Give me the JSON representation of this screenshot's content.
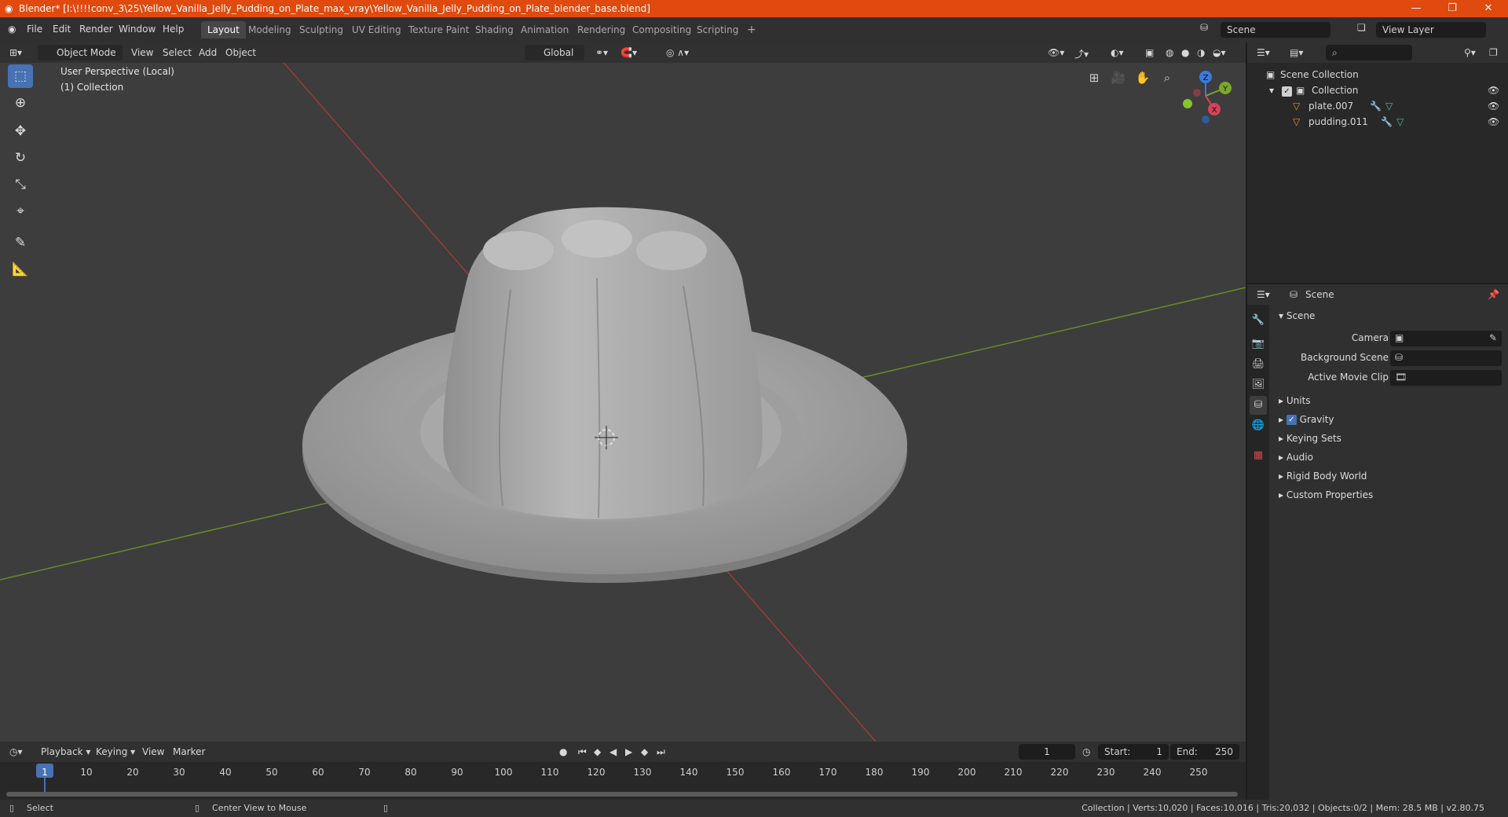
{
  "window": {
    "title": "Blender* [I:\\!!!!conv_3\\25\\Yellow_Vanilla_Jelly_Pudding_on_Plate_max_vray\\Yellow_Vanilla_Jelly_Pudding_on_Plate_blender_base.blend]",
    "minimize": "—",
    "maximize": "❐",
    "close": "✕"
  },
  "menus": [
    "File",
    "Edit",
    "Render",
    "Window",
    "Help"
  ],
  "workspaces": [
    "Layout",
    "Modeling",
    "Sculpting",
    "UV Editing",
    "Texture Paint",
    "Shading",
    "Animation",
    "Rendering",
    "Compositing",
    "Scripting"
  ],
  "add_workspace": "+",
  "scene_field": "Scene",
  "view_layer_field": "View Layer",
  "viewport": {
    "mode": "Object Mode",
    "menus": [
      "View",
      "Select",
      "Add",
      "Object"
    ],
    "transform": "Global",
    "overlay_line1": "User Perspective (Local)",
    "overlay_line2": "(1) Collection",
    "gizmo": {
      "z": "Z",
      "y": "Y",
      "x": "X"
    }
  },
  "outliner": {
    "root": "Scene Collection",
    "collection": "Collection",
    "items": [
      "plate.007",
      "pudding.011"
    ]
  },
  "properties": {
    "header": "Scene",
    "panel": "Scene",
    "camera_label": "Camera",
    "background_label": "Background Scene",
    "movieclip_label": "Active Movie Clip",
    "sections": [
      "Units",
      "Gravity",
      "Keying Sets",
      "Audio",
      "Rigid Body World",
      "Custom Properties"
    ]
  },
  "timeline": {
    "menus": [
      "Playback",
      "Keying",
      "View",
      "Marker"
    ],
    "current_frame": "1",
    "start_label": "Start:",
    "start": "1",
    "end_label": "End:",
    "end": "250",
    "ticks": [
      "1",
      "10",
      "20",
      "30",
      "40",
      "50",
      "60",
      "70",
      "80",
      "90",
      "100",
      "110",
      "120",
      "130",
      "140",
      "150",
      "160",
      "170",
      "180",
      "190",
      "200",
      "210",
      "220",
      "230",
      "240",
      "250"
    ]
  },
  "status": {
    "select": "Select",
    "center": "Center View to Mouse",
    "stats": "Collection | Verts:10,020 | Faces:10,016 | Tris:20,032 | Objects:0/2 | Mem: 28.5 MB | v2.80.75"
  },
  "colors": {
    "titlebar": "#e04a0e",
    "accent": "#4772b3",
    "viewport_bg": "#3d3d3d"
  }
}
